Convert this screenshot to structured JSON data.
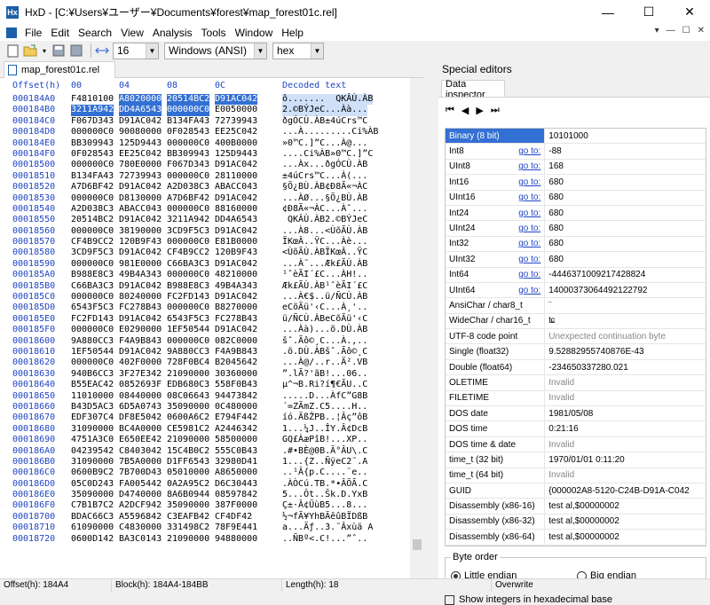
{
  "window": {
    "title": "HxD - [C:¥Users¥ユーザー¥Documents¥forest¥map_forest01c.rel]",
    "app_icon": "hxd-app-icon",
    "minimize_glyph": "—",
    "maximize_glyph": "☐",
    "close_glyph": "✕"
  },
  "menu": {
    "items": [
      "File",
      "Edit",
      "Search",
      "View",
      "Analysis",
      "Tools",
      "Window",
      "Help"
    ],
    "right_controls": [
      "▾",
      "—",
      "☐",
      "✕"
    ]
  },
  "toolbar": {
    "bytes_per_row": "16",
    "charset": "Windows (ANSI)",
    "display_mode": "hex"
  },
  "editor": {
    "tab_label": "map_forest01c.rel",
    "header": {
      "offset": "Offset(h)",
      "cols": [
        "00",
        "04",
        "08",
        "0C"
      ],
      "decoded": "Decoded text"
    },
    "rows": [
      {
        "off": "000184A0",
        "h": [
          "F4810100",
          "A8020000",
          "20514BC2",
          "D91AC042"
        ],
        "t": "ô.......  QKÂÙ.ÀB",
        "sel": [
          1,
          2,
          3
        ]
      },
      {
        "off": "000184B0",
        "h": [
          "3211A942",
          "DD4A6543",
          "000000C0",
          "E0050000"
        ],
        "t": "2.©BÝJeC...Àà...",
        "sel": [
          0,
          1,
          2
        ]
      },
      {
        "off": "000184C0",
        "h": [
          "F067D343",
          "D91AC042",
          "B134FA43",
          "72739943"
        ],
        "t": "ðgÓCÙ.ÀB±4úCrs™C"
      },
      {
        "off": "000184D0",
        "h": [
          "000000C0",
          "90080000",
          "0F028543",
          "EE25C042"
        ],
        "t": "...À.........Ci%ÀB"
      },
      {
        "off": "000184E0",
        "h": [
          "BB309943",
          "125D9443",
          "000000C0",
          "400B0000"
        ],
        "t": "»0™C.]”C...À@..."
      },
      {
        "off": "000184F0",
        "h": [
          "0F028543",
          "EE25C042",
          "BB309943",
          "125D9443"
        ],
        "t": "....Ci%ÀB»0™C.]”C"
      },
      {
        "off": "00018500",
        "h": [
          "000000C0",
          "780E0000",
          "F067D343",
          "D91AC042"
        ],
        "t": "...Àx...ðgÓCÙ.ÀB"
      },
      {
        "off": "00018510",
        "h": [
          "B134FA43",
          "72739943",
          "000000C0",
          "28110000"
        ],
        "t": "±4úCrs™C...À(..."
      },
      {
        "off": "00018520",
        "h": [
          "A7D6BF42",
          "D91AC042",
          "A2D038C3",
          "ABACC043"
        ],
        "t": "§Ö¿BÙ.ÀB¢Ð8Ã«¬ÀC"
      },
      {
        "off": "00018530",
        "h": [
          "000000C0",
          "D8130000",
          "A7D6BF42",
          "D91AC042"
        ],
        "t": "...ÀØ...§Ö¿BÙ.ÀB"
      },
      {
        "off": "00018540",
        "h": [
          "A2D038C3",
          "ABACC043",
          "000000C0",
          "88160000"
        ],
        "t": "¢Ð8Ã«¬ÀC...Àˆ..."
      },
      {
        "off": "00018550",
        "h": [
          "20514BC2",
          "D91AC042",
          "3211A942",
          "DD4A6543"
        ],
        "t": " QKÂÙ.ÀB2.©BÝJeC"
      },
      {
        "off": "00018560",
        "h": [
          "000000C0",
          "38190000",
          "3CD9F5C3",
          "D91AC042"
        ],
        "t": "...À8...<ÙõÃÙ.ÀB"
      },
      {
        "off": "00018570",
        "h": [
          "CF4B9CC2",
          "120B9F43",
          "000000C0",
          "E81B0000"
        ],
        "t": "ÏKœÂ..ŸC...Àè..."
      },
      {
        "off": "00018580",
        "h": [
          "3CD9F5C3",
          "D91AC042",
          "CF4B9CC2",
          "120B9F43"
        ],
        "t": "<ÙõÃÙ.ÀBÏKœÂ..ŸC"
      },
      {
        "off": "00018590",
        "h": [
          "000000C0",
          "981E0000",
          "C66BA3C3",
          "D91AC042"
        ],
        "t": "...À˜...Æk£ÃÙ.ÀB"
      },
      {
        "off": "000185A0",
        "h": [
          "B988E8C3",
          "49B4A343",
          "000000C0",
          "48210000"
        ],
        "t": "¹ˆèÃI´£C...ÀH!.."
      },
      {
        "off": "000185B0",
        "h": [
          "C66BA3C3",
          "D91AC042",
          "B988E8C3",
          "49B4A343"
        ],
        "t": "Æk£ÃÙ.ÀB¹ˆèÃI´£C"
      },
      {
        "off": "000185C0",
        "h": [
          "000000C0",
          "80240000",
          "FC2FD143",
          "D91AC042"
        ],
        "t": "...À€$..ü/ÑCÙ.ÀB"
      },
      {
        "off": "000185D0",
        "h": [
          "6543F5C3",
          "FC278B43",
          "000000C0",
          "B8270000"
        ],
        "t": "eCõÃü'‹C...À¸'.."
      },
      {
        "off": "000185E0",
        "h": [
          "FC2FD143",
          "D91AC042",
          "6543F5C3",
          "FC278B43"
        ],
        "t": "ü/ÑCÙ.ÀBeCõÃü'‹C"
      },
      {
        "off": "000185F0",
        "h": [
          "000000C0",
          "E0290000",
          "1EF50544",
          "D91AC042"
        ],
        "t": "...Àà)...õ.DÙ.ÀB"
      },
      {
        "off": "00018600",
        "h": [
          "9A880CC3",
          "F4A9B843",
          "000000C0",
          "082C0000"
        ],
        "t": "šˆ.Ãô©¸C...À.,.."
      },
      {
        "off": "00018610",
        "h": [
          "1EF50544",
          "D91AC042",
          "9A880CC3",
          "F4A9B843"
        ],
        "t": ".õ.DÙ.ÀBšˆ.Ãô©¸C"
      },
      {
        "off": "00018620",
        "h": [
          "000000C0",
          "402F0000",
          "728F0BC4",
          "B2045642"
        ],
        "t": "...À@/..r..Ä².VB"
      },
      {
        "off": "00018630",
        "h": [
          "940B6CC3",
          "3F27E342",
          "21090000",
          "30360000"
        ],
        "t": "”.lÃ?'ãB!...06.."
      },
      {
        "off": "00018640",
        "h": [
          "B55EAC42",
          "0852693F",
          "EDB680C3",
          "558F0B43"
        ],
        "t": "µ^¬B.Ri?í¶€ÃU..C"
      },
      {
        "off": "00018650",
        "h": [
          "11010000",
          "08440000",
          "08C06643",
          "94473842"
        ],
        "t": ".....D...ÀfC”G8B"
      },
      {
        "off": "00018660",
        "h": [
          "B43D5AC3",
          "6D5A0743",
          "35090000",
          "0C480000"
        ],
        "t": "´=ZÃmZ.C5....H.."
      },
      {
        "off": "00018670",
        "h": [
          "EDF307C4",
          "DF8E5042",
          "0600A6C2",
          "E794F442"
        ],
        "t": "íó.ÄßŽPB..¦Âç”ôB"
      },
      {
        "off": "00018680",
        "h": [
          "31090000",
          "BC4A0000",
          "CE5981C2",
          "A2446342"
        ],
        "t": "1...¼J..ÎY.Â¢DcB"
      },
      {
        "off": "00018690",
        "h": [
          "4751A3C0",
          "E650EE42",
          "21090000",
          "58500000"
        ],
        "t": "GQ£ÀæPîB!...XP.."
      },
      {
        "off": "000186A0",
        "h": [
          "04239542",
          "C8403042",
          "15C4B0C2",
          "555C0B43"
        ],
        "t": ".#•BÈ@0B.Ä°ÂU\\.C"
      },
      {
        "off": "000186B0",
        "h": [
          "31090000",
          "7B5A0000",
          "D1FF6543",
          "32980D41"
        ],
        "t": "1...{Z..ÑÿeC2˜.A"
      },
      {
        "off": "000186C0",
        "h": [
          "0600B9C2",
          "7B700D43",
          "05010000",
          "A8650000"
        ],
        "t": "..¹Â{p.C....¨e.."
      },
      {
        "off": "000186D0",
        "h": [
          "05C0D243",
          "FA005442",
          "0A2A95C2",
          "D6C30443"
        ],
        "t": ".ÀÒCú.TB.*•ÂÖÃ.C"
      },
      {
        "off": "000186E0",
        "h": [
          "35090000",
          "D4740000",
          "8A6B0944",
          "08597842"
        ],
        "t": "5...Ôt..Šk.D.YxB"
      },
      {
        "off": "000186F0",
        "h": [
          "C7B1B7C2",
          "A2DCF942",
          "35090000",
          "387F0000"
        ],
        "t": "Ç±·Â¢ÜùB5...8..."
      },
      {
        "off": "00018700",
        "h": [
          "BDAC66C3",
          "A5596842",
          "C3EAFB42",
          "CF4DF42"
        ],
        "t": "½¬fÃ¥YhBÃêûBÏDßB"
      },
      {
        "off": "00018710",
        "h": [
          "61090000",
          "C4830000",
          "331498C2",
          "78F9E441"
        ],
        "t": "a...Äƒ..3.˜Âxùä A"
      },
      {
        "off": "00018720",
        "h": [
          "0600D142",
          "BA3C0143",
          "21090000",
          "94880000"
        ],
        "t": "..ÑBº<.C!...”ˆ.."
      }
    ]
  },
  "special_editors": {
    "title": "Special editors",
    "tab": "Data inspector",
    "nav": [
      "⏮",
      "◀",
      "▶",
      "⏭"
    ],
    "goto_label": "go to:",
    "rows": [
      {
        "name": "Binary (8 bit)",
        "value": "10101000",
        "goto": false,
        "selected": true
      },
      {
        "name": "Int8",
        "value": "-88",
        "goto": true
      },
      {
        "name": "UInt8",
        "value": "168",
        "goto": true
      },
      {
        "name": "Int16",
        "value": "680",
        "goto": true
      },
      {
        "name": "UInt16",
        "value": "680",
        "goto": true
      },
      {
        "name": "Int24",
        "value": "680",
        "goto": true
      },
      {
        "name": "UInt24",
        "value": "680",
        "goto": true
      },
      {
        "name": "Int32",
        "value": "680",
        "goto": true
      },
      {
        "name": "UInt32",
        "value": "680",
        "goto": true
      },
      {
        "name": "Int64",
        "value": "-4446371009217428824",
        "goto": true
      },
      {
        "name": "UInt64",
        "value": "14000373064492122792",
        "goto": true
      },
      {
        "name": "AnsiChar / char8_t",
        "value": "¨",
        "goto": false
      },
      {
        "name": "WideChar / char16_t",
        "value": "ʨ",
        "goto": false
      },
      {
        "name": "UTF-8 code point",
        "value": "Unexpected continuation byte",
        "goto": false,
        "invalid": true
      },
      {
        "name": "Single (float32)",
        "value": "9.52882955740876E-43",
        "goto": false
      },
      {
        "name": "Double (float64)",
        "value": "-234650337280.021",
        "goto": false
      },
      {
        "name": "OLETIME",
        "value": "Invalid",
        "goto": false,
        "invalid": true
      },
      {
        "name": "FILETIME",
        "value": "Invalid",
        "goto": false,
        "invalid": true
      },
      {
        "name": "DOS date",
        "value": "1981/05/08",
        "goto": false
      },
      {
        "name": "DOS time",
        "value": "0:21:16",
        "goto": false
      },
      {
        "name": "DOS time & date",
        "value": "Invalid",
        "goto": false,
        "invalid": true
      },
      {
        "name": "time_t (32 bit)",
        "value": "1970/01/01 0:11:20",
        "goto": false
      },
      {
        "name": "time_t (64 bit)",
        "value": "Invalid",
        "goto": false,
        "invalid": true
      },
      {
        "name": "GUID",
        "value": "{000002A8-5120-C24B-D91A-C042",
        "goto": false
      },
      {
        "name": "Disassembly (x86-16)",
        "value": "test al,$00000002",
        "goto": false
      },
      {
        "name": "Disassembly (x86-32)",
        "value": "test al,$00000002",
        "goto": false
      },
      {
        "name": "Disassembly (x86-64)",
        "value": "test al,$00000002",
        "goto": false
      }
    ],
    "byte_order": {
      "label": "Byte order",
      "little": "Little endian",
      "big": "Big endian",
      "selected": "little"
    },
    "show_hex_label": "Show integers in hexadecimal base"
  },
  "status": {
    "offset": "Offset(h): 184A4",
    "block": "Block(h): 184A4-184BB",
    "length": "Length(h): 18",
    "mode": "Overwrite"
  }
}
